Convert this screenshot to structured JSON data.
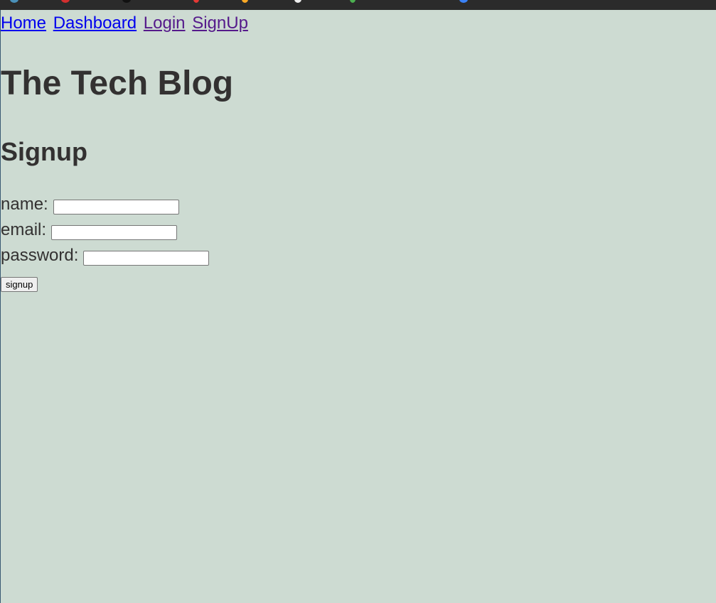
{
  "nav": {
    "links": [
      {
        "label": "Home",
        "visited": false
      },
      {
        "label": "Dashboard",
        "visited": false
      },
      {
        "label": "Login",
        "visited": true
      },
      {
        "label": "SignUp",
        "visited": true
      }
    ]
  },
  "page": {
    "title": "The Tech Blog",
    "section_title": "Signup"
  },
  "form": {
    "name_label": "name:",
    "name_value": "",
    "email_label": "email:",
    "email_value": "",
    "password_label": "password:",
    "password_value": "",
    "submit_label": "signup"
  },
  "colors": {
    "background": "#cddbd2",
    "text": "#333131",
    "link_unvisited": "#0000ee",
    "link_visited": "#551a8b"
  }
}
